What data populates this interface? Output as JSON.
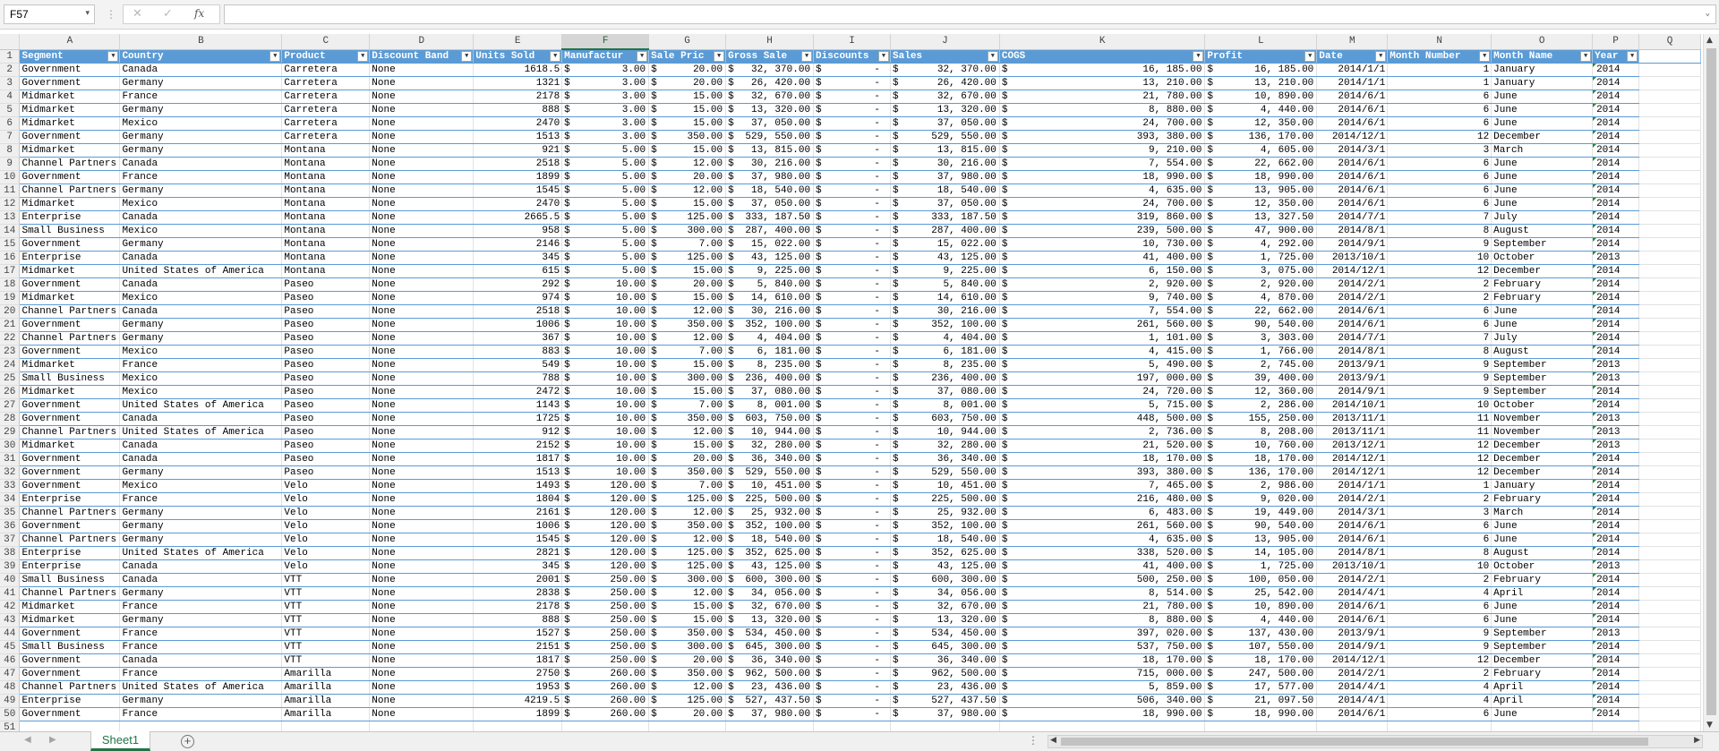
{
  "name_box": "F57",
  "formula_bar": {
    "cancel_icon": "✕",
    "confirm_icon": "✓",
    "fx_label": "fx",
    "value": ""
  },
  "columns": [
    "A",
    "B",
    "C",
    "D",
    "E",
    "F",
    "G",
    "H",
    "I",
    "J",
    "K",
    "L",
    "M",
    "N",
    "O",
    "P",
    "Q"
  ],
  "active_column": "F",
  "headers": [
    "Segment",
    "Country",
    "Product",
    "Discount Band",
    "Units Sold",
    "Manufactur",
    "Sale Pric",
    "Gross Sale",
    "Discounts",
    "Sales",
    "COGS",
    "Profit",
    "Date",
    "Month Number",
    "Month Name",
    "Year"
  ],
  "rows": [
    [
      "Government",
      "Canada",
      "Carretera",
      "None",
      "1618.5",
      "3.00",
      "20.00",
      "32, 370.00",
      "-",
      "32, 370.00",
      "16, 185.00",
      "16, 185.00",
      "2014/1/1",
      "1",
      "January",
      "2014"
    ],
    [
      "Government",
      "Germany",
      "Carretera",
      "None",
      "1321",
      "3.00",
      "20.00",
      "26, 420.00",
      "-",
      "26, 420.00",
      "13, 210.00",
      "13, 210.00",
      "2014/1/1",
      "1",
      "January",
      "2014"
    ],
    [
      "Midmarket",
      "France",
      "Carretera",
      "None",
      "2178",
      "3.00",
      "15.00",
      "32, 670.00",
      "-",
      "32, 670.00",
      "21, 780.00",
      "10, 890.00",
      "2014/6/1",
      "6",
      "June",
      "2014"
    ],
    [
      "Midmarket",
      "Germany",
      "Carretera",
      "None",
      "888",
      "3.00",
      "15.00",
      "13, 320.00",
      "-",
      "13, 320.00",
      "8, 880.00",
      "4, 440.00",
      "2014/6/1",
      "6",
      "June",
      "2014"
    ],
    [
      "Midmarket",
      "Mexico",
      "Carretera",
      "None",
      "2470",
      "3.00",
      "15.00",
      "37, 050.00",
      "-",
      "37, 050.00",
      "24, 700.00",
      "12, 350.00",
      "2014/6/1",
      "6",
      "June",
      "2014"
    ],
    [
      "Government",
      "Germany",
      "Carretera",
      "None",
      "1513",
      "3.00",
      "350.00",
      "529, 550.00",
      "-",
      "529, 550.00",
      "393, 380.00",
      "136, 170.00",
      "2014/12/1",
      "12",
      "December",
      "2014"
    ],
    [
      "Midmarket",
      "Germany",
      "Montana",
      "None",
      "921",
      "5.00",
      "15.00",
      "13, 815.00",
      "-",
      "13, 815.00",
      "9, 210.00",
      "4, 605.00",
      "2014/3/1",
      "3",
      "March",
      "2014"
    ],
    [
      "Channel Partners",
      "Canada",
      "Montana",
      "None",
      "2518",
      "5.00",
      "12.00",
      "30, 216.00",
      "-",
      "30, 216.00",
      "7, 554.00",
      "22, 662.00",
      "2014/6/1",
      "6",
      "June",
      "2014"
    ],
    [
      "Government",
      "France",
      "Montana",
      "None",
      "1899",
      "5.00",
      "20.00",
      "37, 980.00",
      "-",
      "37, 980.00",
      "18, 990.00",
      "18, 990.00",
      "2014/6/1",
      "6",
      "June",
      "2014"
    ],
    [
      "Channel Partners",
      "Germany",
      "Montana",
      "None",
      "1545",
      "5.00",
      "12.00",
      "18, 540.00",
      "-",
      "18, 540.00",
      "4, 635.00",
      "13, 905.00",
      "2014/6/1",
      "6",
      "June",
      "2014"
    ],
    [
      "Midmarket",
      "Mexico",
      "Montana",
      "None",
      "2470",
      "5.00",
      "15.00",
      "37, 050.00",
      "-",
      "37, 050.00",
      "24, 700.00",
      "12, 350.00",
      "2014/6/1",
      "6",
      "June",
      "2014"
    ],
    [
      "Enterprise",
      "Canada",
      "Montana",
      "None",
      "2665.5",
      "5.00",
      "125.00",
      "333, 187.50",
      "-",
      "333, 187.50",
      "319, 860.00",
      "13, 327.50",
      "2014/7/1",
      "7",
      "July",
      "2014"
    ],
    [
      "Small Business",
      "Mexico",
      "Montana",
      "None",
      "958",
      "5.00",
      "300.00",
      "287, 400.00",
      "-",
      "287, 400.00",
      "239, 500.00",
      "47, 900.00",
      "2014/8/1",
      "8",
      "August",
      "2014"
    ],
    [
      "Government",
      "Germany",
      "Montana",
      "None",
      "2146",
      "5.00",
      "7.00",
      "15, 022.00",
      "-",
      "15, 022.00",
      "10, 730.00",
      "4, 292.00",
      "2014/9/1",
      "9",
      "September",
      "2014"
    ],
    [
      "Enterprise",
      "Canada",
      "Montana",
      "None",
      "345",
      "5.00",
      "125.00",
      "43, 125.00",
      "-",
      "43, 125.00",
      "41, 400.00",
      "1, 725.00",
      "2013/10/1",
      "10",
      "October",
      "2013"
    ],
    [
      "Midmarket",
      "United States of America",
      "Montana",
      "None",
      "615",
      "5.00",
      "15.00",
      "9, 225.00",
      "-",
      "9, 225.00",
      "6, 150.00",
      "3, 075.00",
      "2014/12/1",
      "12",
      "December",
      "2014"
    ],
    [
      "Government",
      "Canada",
      "Paseo",
      "None",
      "292",
      "10.00",
      "20.00",
      "5, 840.00",
      "-",
      "5, 840.00",
      "2, 920.00",
      "2, 920.00",
      "2014/2/1",
      "2",
      "February",
      "2014"
    ],
    [
      "Midmarket",
      "Mexico",
      "Paseo",
      "None",
      "974",
      "10.00",
      "15.00",
      "14, 610.00",
      "-",
      "14, 610.00",
      "9, 740.00",
      "4, 870.00",
      "2014/2/1",
      "2",
      "February",
      "2014"
    ],
    [
      "Channel Partners",
      "Canada",
      "Paseo",
      "None",
      "2518",
      "10.00",
      "12.00",
      "30, 216.00",
      "-",
      "30, 216.00",
      "7, 554.00",
      "22, 662.00",
      "2014/6/1",
      "6",
      "June",
      "2014"
    ],
    [
      "Government",
      "Germany",
      "Paseo",
      "None",
      "1006",
      "10.00",
      "350.00",
      "352, 100.00",
      "-",
      "352, 100.00",
      "261, 560.00",
      "90, 540.00",
      "2014/6/1",
      "6",
      "June",
      "2014"
    ],
    [
      "Channel Partners",
      "Germany",
      "Paseo",
      "None",
      "367",
      "10.00",
      "12.00",
      "4, 404.00",
      "-",
      "4, 404.00",
      "1, 101.00",
      "3, 303.00",
      "2014/7/1",
      "7",
      "July",
      "2014"
    ],
    [
      "Government",
      "Mexico",
      "Paseo",
      "None",
      "883",
      "10.00",
      "7.00",
      "6, 181.00",
      "-",
      "6, 181.00",
      "4, 415.00",
      "1, 766.00",
      "2014/8/1",
      "8",
      "August",
      "2014"
    ],
    [
      "Midmarket",
      "France",
      "Paseo",
      "None",
      "549",
      "10.00",
      "15.00",
      "8, 235.00",
      "-",
      "8, 235.00",
      "5, 490.00",
      "2, 745.00",
      "2013/9/1",
      "9",
      "September",
      "2013"
    ],
    [
      "Small Business",
      "Mexico",
      "Paseo",
      "None",
      "788",
      "10.00",
      "300.00",
      "236, 400.00",
      "-",
      "236, 400.00",
      "197, 000.00",
      "39, 400.00",
      "2013/9/1",
      "9",
      "September",
      "2013"
    ],
    [
      "Midmarket",
      "Mexico",
      "Paseo",
      "None",
      "2472",
      "10.00",
      "15.00",
      "37, 080.00",
      "-",
      "37, 080.00",
      "24, 720.00",
      "12, 360.00",
      "2014/9/1",
      "9",
      "September",
      "2014"
    ],
    [
      "Government",
      "United States of America",
      "Paseo",
      "None",
      "1143",
      "10.00",
      "7.00",
      "8, 001.00",
      "-",
      "8, 001.00",
      "5, 715.00",
      "2, 286.00",
      "2014/10/1",
      "10",
      "October",
      "2014"
    ],
    [
      "Government",
      "Canada",
      "Paseo",
      "None",
      "1725",
      "10.00",
      "350.00",
      "603, 750.00",
      "-",
      "603, 750.00",
      "448, 500.00",
      "155, 250.00",
      "2013/11/1",
      "11",
      "November",
      "2013"
    ],
    [
      "Channel Partners",
      "United States of America",
      "Paseo",
      "None",
      "912",
      "10.00",
      "12.00",
      "10, 944.00",
      "-",
      "10, 944.00",
      "2, 736.00",
      "8, 208.00",
      "2013/11/1",
      "11",
      "November",
      "2013"
    ],
    [
      "Midmarket",
      "Canada",
      "Paseo",
      "None",
      "2152",
      "10.00",
      "15.00",
      "32, 280.00",
      "-",
      "32, 280.00",
      "21, 520.00",
      "10, 760.00",
      "2013/12/1",
      "12",
      "December",
      "2013"
    ],
    [
      "Government",
      "Canada",
      "Paseo",
      "None",
      "1817",
      "10.00",
      "20.00",
      "36, 340.00",
      "-",
      "36, 340.00",
      "18, 170.00",
      "18, 170.00",
      "2014/12/1",
      "12",
      "December",
      "2014"
    ],
    [
      "Government",
      "Germany",
      "Paseo",
      "None",
      "1513",
      "10.00",
      "350.00",
      "529, 550.00",
      "-",
      "529, 550.00",
      "393, 380.00",
      "136, 170.00",
      "2014/12/1",
      "12",
      "December",
      "2014"
    ],
    [
      "Government",
      "Mexico",
      "Velo",
      "None",
      "1493",
      "120.00",
      "7.00",
      "10, 451.00",
      "-",
      "10, 451.00",
      "7, 465.00",
      "2, 986.00",
      "2014/1/1",
      "1",
      "January",
      "2014"
    ],
    [
      "Enterprise",
      "France",
      "Velo",
      "None",
      "1804",
      "120.00",
      "125.00",
      "225, 500.00",
      "-",
      "225, 500.00",
      "216, 480.00",
      "9, 020.00",
      "2014/2/1",
      "2",
      "February",
      "2014"
    ],
    [
      "Channel Partners",
      "Germany",
      "Velo",
      "None",
      "2161",
      "120.00",
      "12.00",
      "25, 932.00",
      "-",
      "25, 932.00",
      "6, 483.00",
      "19, 449.00",
      "2014/3/1",
      "3",
      "March",
      "2014"
    ],
    [
      "Government",
      "Germany",
      "Velo",
      "None",
      "1006",
      "120.00",
      "350.00",
      "352, 100.00",
      "-",
      "352, 100.00",
      "261, 560.00",
      "90, 540.00",
      "2014/6/1",
      "6",
      "June",
      "2014"
    ],
    [
      "Channel Partners",
      "Germany",
      "Velo",
      "None",
      "1545",
      "120.00",
      "12.00",
      "18, 540.00",
      "-",
      "18, 540.00",
      "4, 635.00",
      "13, 905.00",
      "2014/6/1",
      "6",
      "June",
      "2014"
    ],
    [
      "Enterprise",
      "United States of America",
      "Velo",
      "None",
      "2821",
      "120.00",
      "125.00",
      "352, 625.00",
      "-",
      "352, 625.00",
      "338, 520.00",
      "14, 105.00",
      "2014/8/1",
      "8",
      "August",
      "2014"
    ],
    [
      "Enterprise",
      "Canada",
      "Velo",
      "None",
      "345",
      "120.00",
      "125.00",
      "43, 125.00",
      "-",
      "43, 125.00",
      "41, 400.00",
      "1, 725.00",
      "2013/10/1",
      "10",
      "October",
      "2013"
    ],
    [
      "Small Business",
      "Canada",
      "VTT",
      "None",
      "2001",
      "250.00",
      "300.00",
      "600, 300.00",
      "-",
      "600, 300.00",
      "500, 250.00",
      "100, 050.00",
      "2014/2/1",
      "2",
      "February",
      "2014"
    ],
    [
      "Channel Partners",
      "Germany",
      "VTT",
      "None",
      "2838",
      "250.00",
      "12.00",
      "34, 056.00",
      "-",
      "34, 056.00",
      "8, 514.00",
      "25, 542.00",
      "2014/4/1",
      "4",
      "April",
      "2014"
    ],
    [
      "Midmarket",
      "France",
      "VTT",
      "None",
      "2178",
      "250.00",
      "15.00",
      "32, 670.00",
      "-",
      "32, 670.00",
      "21, 780.00",
      "10, 890.00",
      "2014/6/1",
      "6",
      "June",
      "2014"
    ],
    [
      "Midmarket",
      "Germany",
      "VTT",
      "None",
      "888",
      "250.00",
      "15.00",
      "13, 320.00",
      "-",
      "13, 320.00",
      "8, 880.00",
      "4, 440.00",
      "2014/6/1",
      "6",
      "June",
      "2014"
    ],
    [
      "Government",
      "France",
      "VTT",
      "None",
      "1527",
      "250.00",
      "350.00",
      "534, 450.00",
      "-",
      "534, 450.00",
      "397, 020.00",
      "137, 430.00",
      "2013/9/1",
      "9",
      "September",
      "2013"
    ],
    [
      "Small Business",
      "France",
      "VTT",
      "None",
      "2151",
      "250.00",
      "300.00",
      "645, 300.00",
      "-",
      "645, 300.00",
      "537, 750.00",
      "107, 550.00",
      "2014/9/1",
      "9",
      "September",
      "2014"
    ],
    [
      "Government",
      "Canada",
      "VTT",
      "None",
      "1817",
      "250.00",
      "20.00",
      "36, 340.00",
      "-",
      "36, 340.00",
      "18, 170.00",
      "18, 170.00",
      "2014/12/1",
      "12",
      "December",
      "2014"
    ],
    [
      "Government",
      "France",
      "Amarilla",
      "None",
      "2750",
      "260.00",
      "350.00",
      "962, 500.00",
      "-",
      "962, 500.00",
      "715, 000.00",
      "247, 500.00",
      "2014/2/1",
      "2",
      "February",
      "2014"
    ],
    [
      "Channel Partners",
      "United States of America",
      "Amarilla",
      "None",
      "1953",
      "260.00",
      "12.00",
      "23, 436.00",
      "-",
      "23, 436.00",
      "5, 859.00",
      "17, 577.00",
      "2014/4/1",
      "4",
      "April",
      "2014"
    ],
    [
      "Enterprise",
      "Germany",
      "Amarilla",
      "None",
      "4219.5",
      "260.00",
      "125.00",
      "527, 437.50",
      "-",
      "527, 437.50",
      "506, 340.00",
      "21, 097.50",
      "2014/4/1",
      "4",
      "April",
      "2014"
    ],
    [
      "Government",
      "France",
      "Amarilla",
      "None",
      "1899",
      "260.00",
      "20.00",
      "37, 980.00",
      "-",
      "37, 980.00",
      "18, 990.00",
      "18, 990.00",
      "2014/6/1",
      "6",
      "June",
      "2014"
    ]
  ],
  "currency_symbol": "$",
  "extra_row_number": "51",
  "sheet_tabs": [
    "Sheet1"
  ],
  "icons": {
    "add_sheet": "plus-icon",
    "filter": "filter-dropdown-icon",
    "nav_prev": "triangle-left-icon",
    "nav_next": "triangle-right-icon"
  }
}
